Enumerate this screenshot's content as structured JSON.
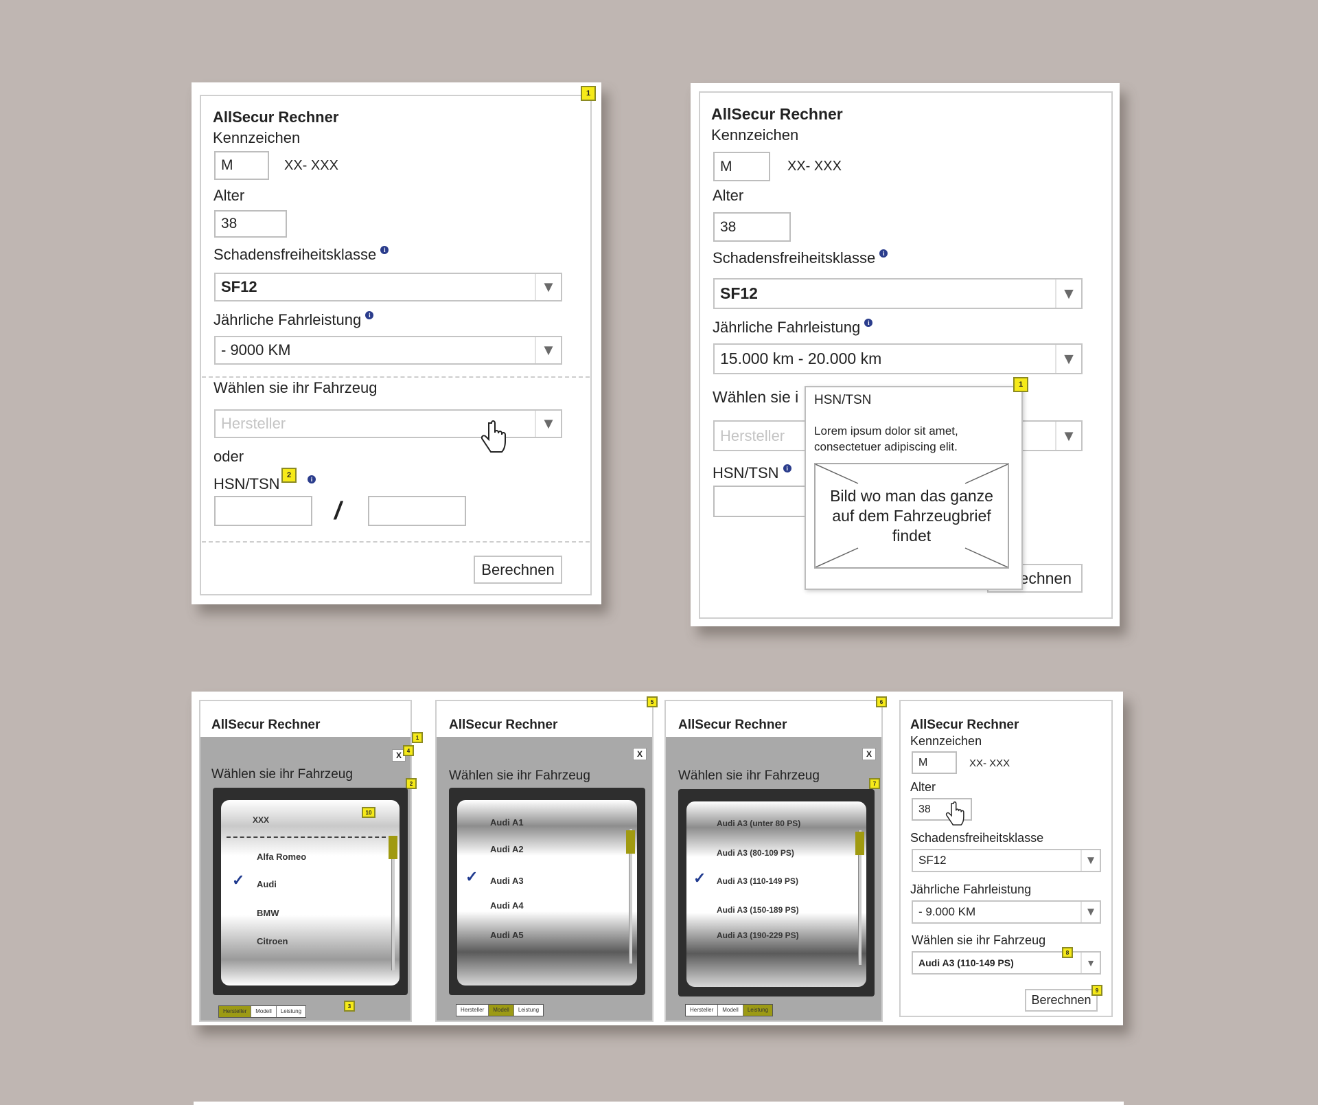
{
  "calculator": {
    "title": "AllSecur Rechner",
    "kennzeichen_label": "Kennzeichen",
    "kennzeichen_value": "M",
    "kennzeichen_suffix": "XX- XXX",
    "alter_label": "Alter",
    "alter_value": "38",
    "sf_label": "Schadensfreiheitsklasse",
    "sf_value": "SF12",
    "km_label": "Jährliche Fahrleistung",
    "km_value_a": "- 9000 KM",
    "km_value_b": "15.000 km - 20.000 km",
    "km_value_d": "- 9.000 KM",
    "vehicle_label": "Wählen sie ihr Fahrzeug",
    "vehicle_label_cut": "Wählen sie i",
    "hersteller_placeholder": "Hersteller",
    "oder": "oder",
    "hsn_label": "HSN/TSN",
    "slash": "/",
    "berechnen": "Berechnen",
    "berechnen_cut": "echnen",
    "vehicle_selected": "Audi A3 (110-149 PS)"
  },
  "tooltip": {
    "title": "HSN/TSN",
    "text": "Lorem ipsum dolor sit amet, consectetuer adipiscing elit.",
    "image_caption": "Bild wo man das ganze auf dem Fahrzeugbrief findet"
  },
  "pickers": {
    "hersteller": [
      "XXX",
      "Alfa Romeo",
      "Audi",
      "BMW",
      "Citroen"
    ],
    "modell": [
      "Audi A1",
      "Audi A2",
      "Audi A3",
      "Audi A4",
      "Audi A5"
    ],
    "leistung": [
      "Audi A3 (unter 80 PS)",
      "Audi A3 (80-109 PS)",
      "Audi A3 (110-149 PS)",
      "Audi A3 (150-189 PS)",
      "Audi A3 (190-229 PS)"
    ],
    "checkmark": "✓",
    "close": "X",
    "tabs": [
      "Hersteller",
      "Modell",
      "Leistung"
    ]
  },
  "badges": [
    "1",
    "2",
    "3",
    "4",
    "5",
    "6",
    "7",
    "8",
    "9",
    "10"
  ],
  "icons": {
    "info": "info-icon",
    "cursor": "hand-cursor-icon",
    "dropdown": "chevron-down-icon"
  },
  "colors": {
    "background": "#bfb6b2",
    "badge": "#f6ea19",
    "highlight": "#9c9a14",
    "info": "#2a3c8c"
  }
}
